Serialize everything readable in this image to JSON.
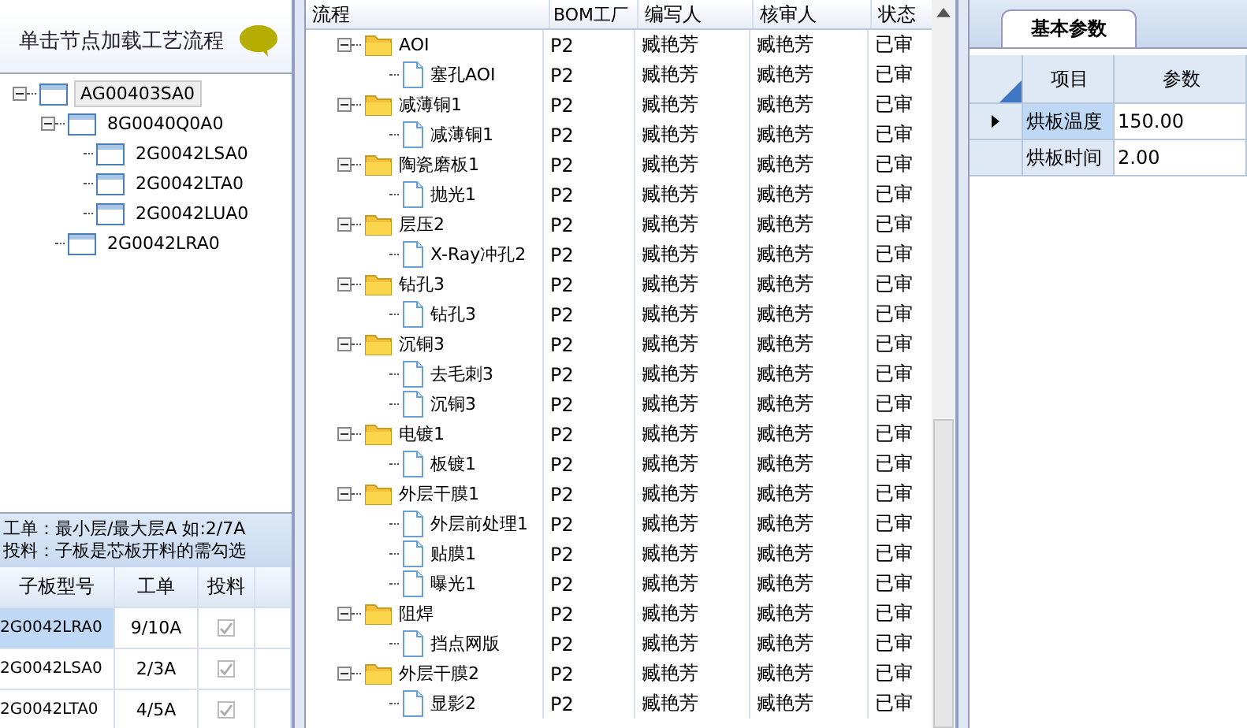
{
  "left_panel": {
    "title": "单击节点加载工艺流程",
    "tree": [
      {
        "label": "AG00403SA0",
        "expanded": true,
        "selected": true,
        "children": [
          {
            "label": "8G0040Q0A0",
            "expanded": true,
            "selected": false,
            "children": [
              {
                "label": "2G0042LSA0",
                "selected": false
              },
              {
                "label": "2G0042LTA0",
                "selected": false
              },
              {
                "label": "2G0042LUA0",
                "selected": false
              }
            ]
          },
          {
            "label": "2G0042LRA0",
            "selected": false
          }
        ]
      }
    ],
    "hint_lines": [
      "工单：最小层/最大层A 如:2/7A",
      "投料：子板是芯板开料的需勾选"
    ],
    "grid": {
      "columns": [
        "子板型号",
        "工单",
        "投料"
      ],
      "rows": [
        {
          "board": "2G0042LRA0",
          "order": "9/10A",
          "checked": true,
          "selected": true
        },
        {
          "board": "2G0042LSA0",
          "order": "2/3A",
          "checked": true,
          "selected": false
        },
        {
          "board": "2G0042LTA0",
          "order": "4/5A",
          "checked": true,
          "selected": false
        }
      ]
    }
  },
  "flow_grid": {
    "columns": [
      "流程",
      "BOM工厂",
      "编写人",
      "核审人",
      "状态"
    ],
    "rows": [
      {
        "label": "AOI",
        "bom": "P2",
        "writer": "臧艳芳",
        "reviewer": "臧艳芳",
        "status": "已审",
        "expanded": true,
        "children": [
          {
            "label": "塞孔AOI",
            "bom": "P2",
            "writer": "臧艳芳",
            "reviewer": "臧艳芳",
            "status": "已审"
          }
        ]
      },
      {
        "label": "减薄铜1",
        "bom": "P2",
        "writer": "臧艳芳",
        "reviewer": "臧艳芳",
        "status": "已审",
        "expanded": true,
        "children": [
          {
            "label": "减薄铜1",
            "bom": "P2",
            "writer": "臧艳芳",
            "reviewer": "臧艳芳",
            "status": "已审"
          }
        ]
      },
      {
        "label": "陶瓷磨板1",
        "bom": "P2",
        "writer": "臧艳芳",
        "reviewer": "臧艳芳",
        "status": "已审",
        "expanded": true,
        "children": [
          {
            "label": "抛光1",
            "bom": "P2",
            "writer": "臧艳芳",
            "reviewer": "臧艳芳",
            "status": "已审"
          }
        ]
      },
      {
        "label": "层压2",
        "bom": "P2",
        "writer": "臧艳芳",
        "reviewer": "臧艳芳",
        "status": "已审",
        "expanded": true,
        "children": [
          {
            "label": "X-Ray冲孔2",
            "bom": "P2",
            "writer": "臧艳芳",
            "reviewer": "臧艳芳",
            "status": "已审"
          }
        ]
      },
      {
        "label": "钻孔3",
        "bom": "P2",
        "writer": "臧艳芳",
        "reviewer": "臧艳芳",
        "status": "已审",
        "expanded": true,
        "children": [
          {
            "label": "钻孔3",
            "bom": "P2",
            "writer": "臧艳芳",
            "reviewer": "臧艳芳",
            "status": "已审"
          }
        ]
      },
      {
        "label": "沉铜3",
        "bom": "P2",
        "writer": "臧艳芳",
        "reviewer": "臧艳芳",
        "status": "已审",
        "expanded": true,
        "children": [
          {
            "label": "去毛刺3",
            "bom": "P2",
            "writer": "臧艳芳",
            "reviewer": "臧艳芳",
            "status": "已审"
          },
          {
            "label": "沉铜3",
            "bom": "P2",
            "writer": "臧艳芳",
            "reviewer": "臧艳芳",
            "status": "已审"
          }
        ]
      },
      {
        "label": "电镀1",
        "bom": "P2",
        "writer": "臧艳芳",
        "reviewer": "臧艳芳",
        "status": "已审",
        "expanded": true,
        "children": [
          {
            "label": "板镀1",
            "bom": "P2",
            "writer": "臧艳芳",
            "reviewer": "臧艳芳",
            "status": "已审"
          }
        ]
      },
      {
        "label": "外层干膜1",
        "bom": "P2",
        "writer": "臧艳芳",
        "reviewer": "臧艳芳",
        "status": "已审",
        "expanded": true,
        "children": [
          {
            "label": "外层前处理1",
            "bom": "P2",
            "writer": "臧艳芳",
            "reviewer": "臧艳芳",
            "status": "已审"
          },
          {
            "label": "贴膜1",
            "bom": "P2",
            "writer": "臧艳芳",
            "reviewer": "臧艳芳",
            "status": "已审"
          },
          {
            "label": "曝光1",
            "bom": "P2",
            "writer": "臧艳芳",
            "reviewer": "臧艳芳",
            "status": "已审"
          }
        ]
      },
      {
        "label": "阻焊",
        "bom": "P2",
        "writer": "臧艳芳",
        "reviewer": "臧艳芳",
        "status": "已审",
        "expanded": true,
        "children": [
          {
            "label": "挡点网版",
            "bom": "P2",
            "writer": "臧艳芳",
            "reviewer": "臧艳芳",
            "status": "已审"
          }
        ]
      },
      {
        "label": "外层干膜2",
        "bom": "P2",
        "writer": "臧艳芳",
        "reviewer": "臧艳芳",
        "status": "已审",
        "expanded": true,
        "children": [
          {
            "label": "显影2",
            "bom": "P2",
            "writer": "臧艳芳",
            "reviewer": "臧艳芳",
            "status": "已审"
          }
        ]
      }
    ]
  },
  "right_panel": {
    "tabs": [
      {
        "label": "基本参数",
        "selected": true
      }
    ],
    "grid": {
      "columns": [
        "项目",
        "参数"
      ],
      "rows": [
        {
          "item": "烘板温度",
          "value": "150.00",
          "selected": true
        },
        {
          "item": "烘板时间",
          "value": "2.00",
          "selected": false
        }
      ]
    }
  }
}
